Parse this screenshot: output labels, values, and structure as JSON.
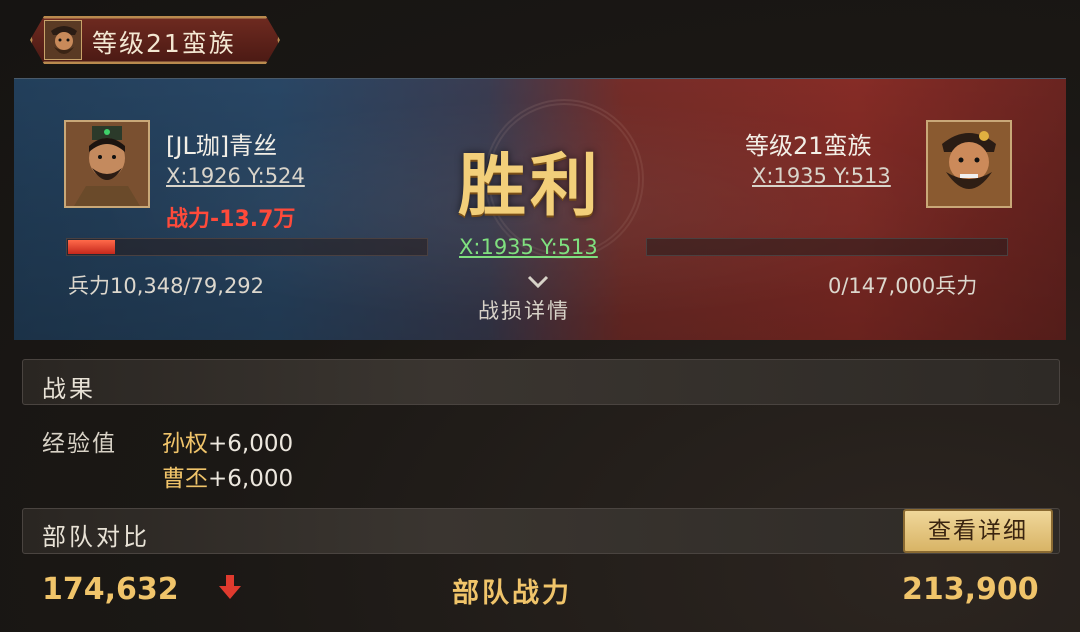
{
  "header": {
    "title": "等级21蛮族"
  },
  "battle": {
    "result": "胜利",
    "center_coord": "X:1935 Y:513",
    "loss_details_label": "战损详情",
    "attacker": {
      "name": "[JL珈]青丝",
      "coord": "X:1926 Y:524",
      "power_change": "战力-13.7万",
      "troops_text": "兵力10,348/79,292",
      "troops_fraction": 0.1305
    },
    "defender": {
      "name": "等级21蛮族",
      "coord": "X:1935 Y:513",
      "troops_text": "0/147,000兵力",
      "troops_fraction": 0
    }
  },
  "results": {
    "title": "战果",
    "exp_label": "经验值",
    "rewards": [
      {
        "hero": "孙权",
        "amount": "+6,000"
      },
      {
        "hero": "曹丕",
        "amount": "+6,000"
      }
    ]
  },
  "comparison": {
    "title": "部队对比",
    "detail_button": "查看详细",
    "left_power": "174,632",
    "mid_label": "部队战力",
    "right_power": "213,900"
  },
  "icons": {
    "chevron": "chevron-down-icon",
    "arrow": "arrow-down-icon"
  },
  "colors": {
    "loss_red": "#ff4a3a",
    "gold": "#f0c46a",
    "coord_green": "#7fe07f"
  }
}
